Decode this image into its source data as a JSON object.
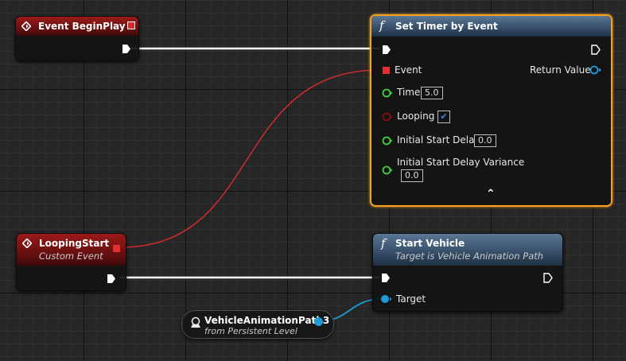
{
  "nodes": {
    "begin_play": {
      "title": "Event BeginPlay"
    },
    "set_timer": {
      "title": "Set Timer by Event",
      "event_label": "Event",
      "return_label": "Return Value",
      "time_label": "Time",
      "time_value": "5.0",
      "looping_label": "Looping",
      "looping_checked": "✔",
      "initial_delay_label": "Initial Start Delay",
      "initial_delay_value": "0.0",
      "variance_label": "Initial Start Delay Variance",
      "variance_value": "0.0",
      "collapse_glyph": "⌃"
    },
    "looping_start": {
      "title": "LoopingStart",
      "subtitle": "Custom Event"
    },
    "start_vehicle": {
      "title": "Start Vehicle",
      "subtitle": "Target is Vehicle Animation Path",
      "target_label": "Target"
    },
    "vehicle_var": {
      "title": "VehicleAnimationPath3",
      "subtitle": "from Persistent Level"
    }
  },
  "colors": {
    "exec_wire": "#ffffff",
    "event_wire": "#c82c2c",
    "object_wire": "#1f9ad6",
    "float_pin": "#3fcf3f",
    "bool_pin": "#8a0d0d",
    "selection": "#f4a020"
  },
  "icons": [
    "event-diamond-icon",
    "function-icon",
    "exec-pin-icon",
    "delegate-pin-icon",
    "object-pin-icon",
    "checkmark-icon",
    "collapse-chevron-icon",
    "actor-reference-icon"
  ]
}
